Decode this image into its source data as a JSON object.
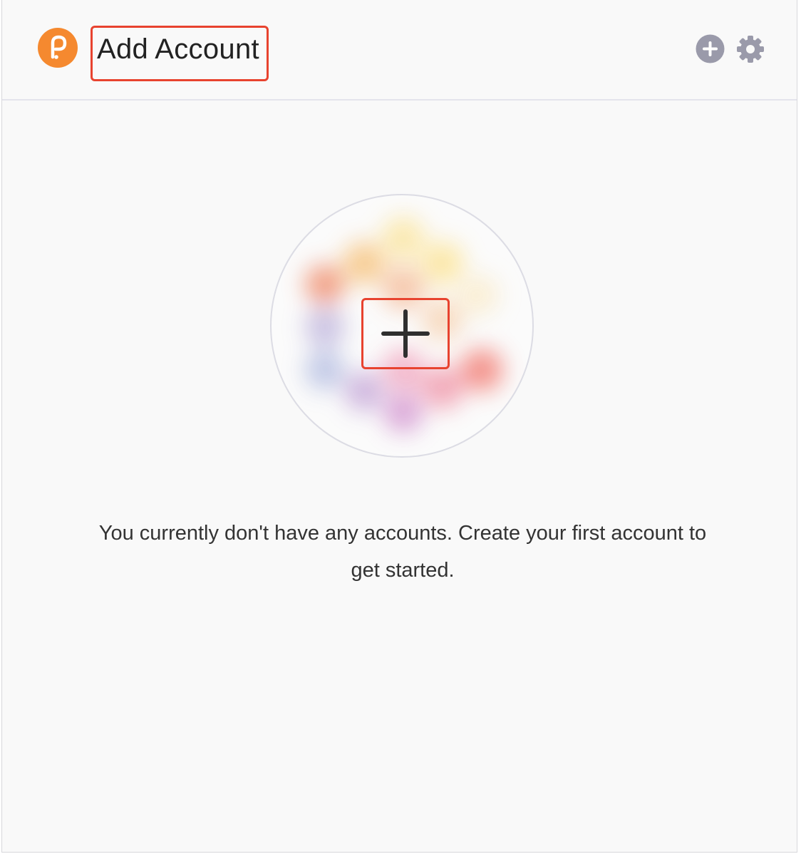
{
  "header": {
    "title": "Add Account",
    "logo_icon": "polkadot-logo-icon",
    "add_icon": "plus-circle-icon",
    "settings_icon": "gear-icon"
  },
  "main": {
    "identicon_icon": "blurred-identicon",
    "add_account_icon": "plus-icon",
    "message": "You currently don't have any accounts. Create your first account to get started."
  },
  "colors": {
    "brand": "#f5892f",
    "icon_gray": "#9a9aaa",
    "highlight": "#e8432f",
    "background": "#f9f9f9"
  }
}
